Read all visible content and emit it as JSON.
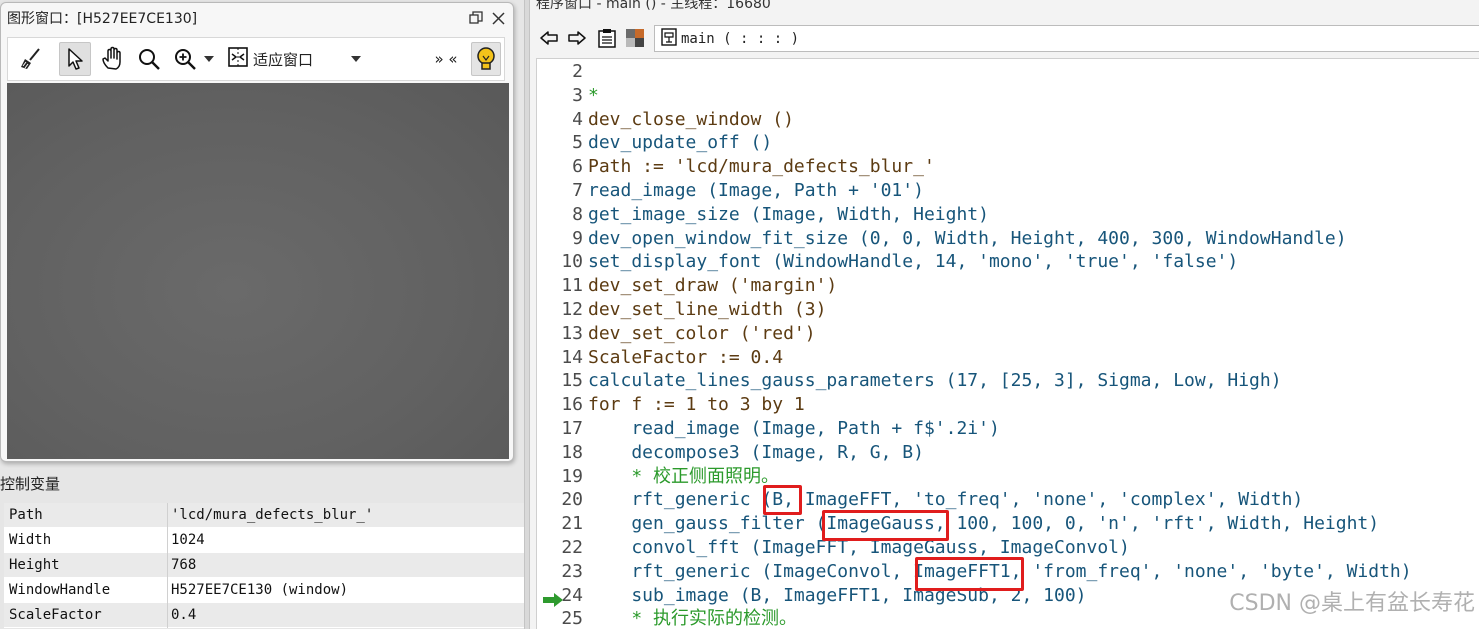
{
  "graphics_window": {
    "title": "图形窗口：[H527EE7CE130]",
    "toolbar": {
      "fit_label": "适应窗口",
      "overflow": "» «"
    },
    "icons": [
      "broom-icon",
      "pointer-icon",
      "hand-icon",
      "magnifier-icon",
      "zoom-in-icon",
      "dropdown-icon",
      "fit-window-icon",
      "lightbulb-icon"
    ]
  },
  "control_vars": {
    "title": "控制变量",
    "rows": [
      {
        "name": "Path",
        "value": "'lcd/mura_defects_blur_'"
      },
      {
        "name": "Width",
        "value": "1024"
      },
      {
        "name": "Height",
        "value": "768"
      },
      {
        "name": "WindowHandle",
        "value": "H527EE7CE130 (window)"
      },
      {
        "name": "ScaleFactor",
        "value": "0.4"
      }
    ]
  },
  "program_window": {
    "title": "程序窗口 - main () - 主线程：16680",
    "procedure": "main ( : : : )"
  },
  "code_lines": [
    {
      "n": "2",
      "segments": []
    },
    {
      "n": "3",
      "segments": [
        {
          "t": "*",
          "c": "c-cmt"
        }
      ]
    },
    {
      "n": "4",
      "segments": [
        {
          "t": "dev_close_window ()",
          "c": "c-op"
        }
      ]
    },
    {
      "n": "5",
      "segments": [
        {
          "t": "dev_update_off ()",
          "c": "c-ctl"
        }
      ]
    },
    {
      "n": "6",
      "segments": [
        {
          "t": "Path := 'lcd/mura_defects_blur_'",
          "c": "c-op"
        }
      ]
    },
    {
      "n": "7",
      "segments": [
        {
          "t": "read_image (Image, Path + '01')",
          "c": "c-ctl"
        }
      ]
    },
    {
      "n": "8",
      "segments": [
        {
          "t": "get_image_size (Image, Width, Height)",
          "c": "c-ctl"
        }
      ]
    },
    {
      "n": "9",
      "segments": [
        {
          "t": "dev_open_window_fit_size (0, 0, Width, Height, 400, 300, WindowHandle)",
          "c": "c-ctl"
        }
      ]
    },
    {
      "n": "10",
      "segments": [
        {
          "t": "set_display_font (WindowHandle, 14, 'mono', 'true', 'false')",
          "c": "c-ctl"
        }
      ]
    },
    {
      "n": "11",
      "segments": [
        {
          "t": "dev_set_draw ('margin')",
          "c": "c-op"
        }
      ]
    },
    {
      "n": "12",
      "segments": [
        {
          "t": "dev_set_line_width (3)",
          "c": "c-op"
        }
      ]
    },
    {
      "n": "13",
      "segments": [
        {
          "t": "dev_set_color ('red')",
          "c": "c-op"
        }
      ]
    },
    {
      "n": "14",
      "segments": [
        {
          "t": "ScaleFactor := 0.4",
          "c": "c-op"
        }
      ]
    },
    {
      "n": "15",
      "segments": [
        {
          "t": "calculate_lines_gauss_parameters (17, [25, 3], Sigma, Low, High)",
          "c": "c-ctl"
        }
      ]
    },
    {
      "n": "16",
      "segments": [
        {
          "t": "for f := 1 to 3 by 1",
          "c": "c-kw"
        }
      ]
    },
    {
      "n": "17",
      "segments": [
        {
          "t": "    read_image (Image, Path + f$'.2i')",
          "c": "c-ctl"
        }
      ]
    },
    {
      "n": "18",
      "segments": [
        {
          "t": "    decompose3 (Image, R, G, B)",
          "c": "c-ctl"
        }
      ]
    },
    {
      "n": "19",
      "segments": [
        {
          "t": "    * 校正侧面照明。",
          "c": "c-cmt"
        }
      ]
    },
    {
      "n": "20",
      "segments": [
        {
          "t": "    rft_generic (B, ImageFFT, 'to_freq', 'none', 'complex', Width)",
          "c": "c-ctl"
        }
      ]
    },
    {
      "n": "21",
      "segments": [
        {
          "t": "    gen_gauss_filter (ImageGauss, 100, 100, 0, 'n', 'rft', Width, Height)",
          "c": "c-ctl"
        }
      ]
    },
    {
      "n": "22",
      "segments": [
        {
          "t": "    convol_fft (ImageFFT, ImageGauss, ImageConvol)",
          "c": "c-ctl"
        }
      ]
    },
    {
      "n": "23",
      "segments": [
        {
          "t": "    rft_generic (ImageConvol, ImageFFT1, 'from_freq', 'none', 'byte', Width)",
          "c": "c-ctl"
        }
      ]
    },
    {
      "n": "24",
      "segments": [
        {
          "t": "    sub_image (B, ImageFFT1, ImageSub, 2, 100)",
          "c": "c-ctl"
        }
      ]
    },
    {
      "n": "25",
      "segments": [
        {
          "t": "    * 执行实际的检测。",
          "c": "c-cmt"
        }
      ]
    }
  ],
  "current_line": "24",
  "highlight_colors": {
    "box": "#e01d1d",
    "pc_arrow": "#2e9a2e"
  },
  "watermark": "CSDN @桌上有盆长寿花"
}
